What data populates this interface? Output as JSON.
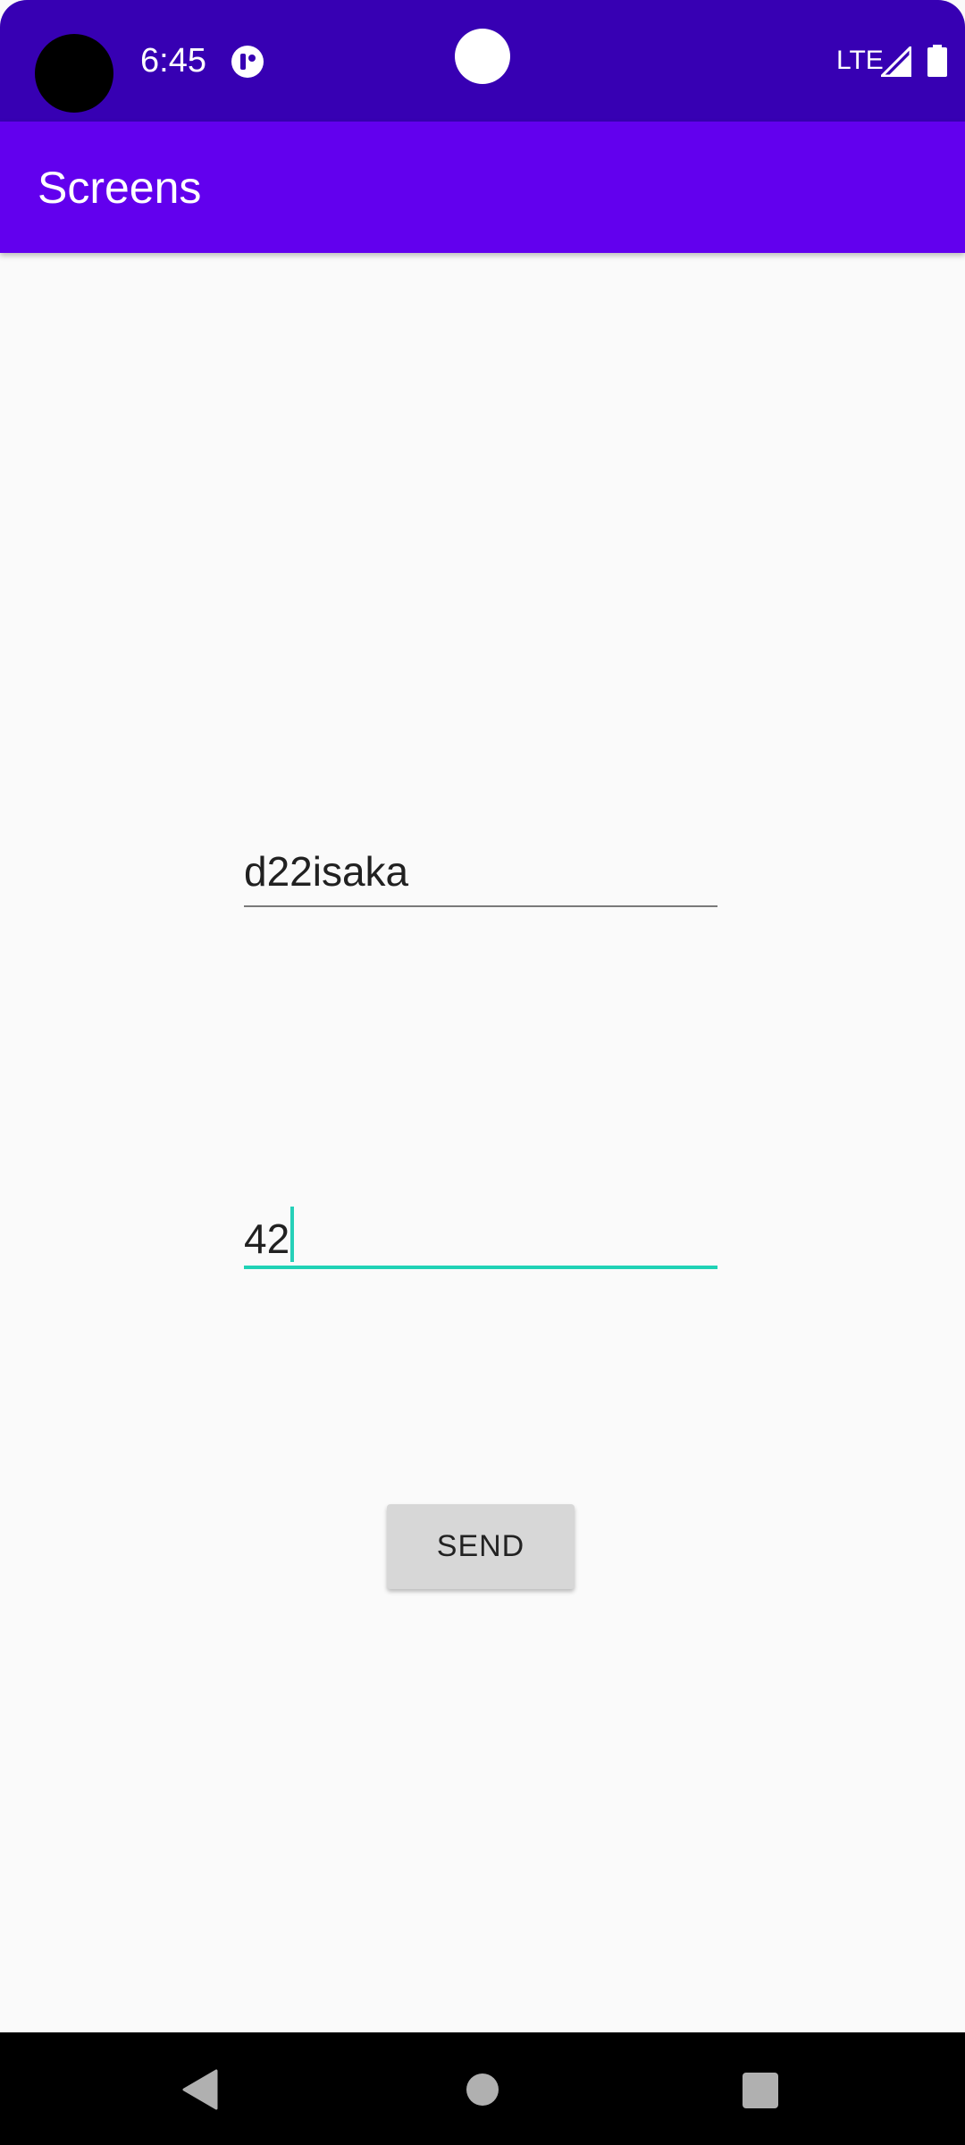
{
  "status_bar": {
    "time": "6:45",
    "network": "LTE",
    "icons": [
      "camera-cutout",
      "app-notification-icon",
      "signal-icon",
      "battery-icon"
    ]
  },
  "app_bar": {
    "title": "Screens",
    "color": "#6200ee"
  },
  "form": {
    "name_value": "d22isaka",
    "age_value": "42",
    "accent_color": "#1fd2b5",
    "send_label": "SEND"
  },
  "nav_bar": {
    "icons": [
      "back-icon",
      "home-icon",
      "recents-icon"
    ]
  }
}
